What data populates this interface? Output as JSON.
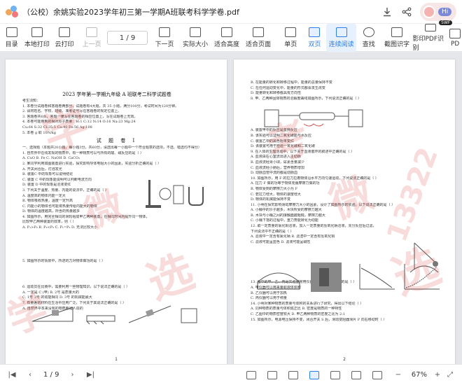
{
  "app": {
    "title": "（公校）余姚实验2023学年初三第一学期A班联考科学学卷.pdf",
    "avatar_label": "Hi"
  },
  "toolbar": {
    "items": [
      {
        "label": "目录"
      },
      {
        "label": "本地打印"
      },
      {
        "label": "云打印"
      },
      {
        "label": "上一页"
      },
      {
        "label": "下一页"
      },
      {
        "label": "实际大小"
      },
      {
        "label": "适合高度"
      },
      {
        "label": "适合页面"
      },
      {
        "label": "单页"
      },
      {
        "label": "双页"
      },
      {
        "label": "连续阅读"
      },
      {
        "label": "查找"
      },
      {
        "label": "截图识字"
      },
      {
        "label": "影印PDF识别"
      },
      {
        "label": "PD"
      }
    ],
    "page_indicator": "1 / 9",
    "badge": "SWF"
  },
  "page1": {
    "title": "2023 学年第一学期九年级 A 班联考二科学试题卷",
    "notice_head": "考生须知：",
    "notice": [
      "1. 本卷分试题卷和答题卷两部分，试题卷有4大题，共 35 小题，满分100分，考试时间为120分钟。",
      "2. 请将姓名、学校、班级、准考证号写在答题卷的规定位置上。",
      "3. 答题卷共6页，答题一律写在答题卷的相应位置上，写在试题卷上无效。",
      "4. 本卷可能用到的相对原子质量：H:1 C:12 N:14 O:16 Na:23 Mg:24",
      "   Cu:64 S:32 Cl:35.5 Ca:40 Fe:56 Ag:108",
      "5. 本卷 g 取 10N/kg"
    ],
    "section_title": "试 题 卷 Ⅰ",
    "questions": [
      "一、选择题（本题共20小题，每小题3分，共60分，请选出每一小题中一个符合题意的选项，不选、错选均不得分）",
      "1. 自然界中在线发现的物质中，有一种物质可以与所有的酸、碱反应的是（  ）",
      "  A. CuO   B. Fe   C. NaOH   D. CaCO₃",
      "2. 某同学利用如图装置进行实验，探究影响导体电阻大小的因素，实验分析正确的是（  ）",
      "  A. 开关闭合后，灯泡发光",
      "  B. 装置C 中的现象可以说明结论",
      "  C. 装置 C 中的现象能说明可以判断电流方向",
      "  D. 装置 D 中的现象是溶液变红",
      "3. 下列关于温度、热量、内能的说法中，正确的是（  ）",
      "  A. 温度高的物体内能一定大",
      "  B. 物体吸收热量，温度一定升高",
      "  C. 内能小的物体也可能将热量传给内能大的物体",
      "  D. 物体的温度越高，所含的热量越多",
      "4. 如图所示，用完全相同的滑轮组成甲乙两种装置，在相同时间内提升同一物体，",
      "  比较甲乙两种装置的效率，则（  ）",
      "  A. P₁>P₂   B. P₁<P₂   C. P₁=P₂   D. 无法比较大小",
      "5. 如图所示的情景中，所述的力对物体做功的是（  ）",
      "6. 运动员在比赛中，需要利用一些物理知识，以下说法正确的是（  ）",
      "  A. 一定是 C (甲)   B. 2号 是质量大的",
      "  C. 1号 3号 的动能相同   D. 3号 的机械能最大",
      "7. 有量差的材料在生活中应用广泛，下列关于其说法正确的是（  ）",
      "  A. 自然界中本来没有的物质都是人造的"
    ],
    "page_number": "1"
  },
  "page2": {
    "lines": [
      "B. 在能量的转化和转移过程中，能量的总量保持不变",
      "C. 在任何运动变化中，能量的形式都会发生改变",
      "D. 能量转化和转移都具有方向性",
      "8. 甲、乙两种固体物质的溶解度曲线如图所示，下列说法正确的是（  ）",
      "  A. 装置甲中的反应是置换反应",
      "  B. 该实验可以证明二氧化碳能与水反应",
      "  C. 装置乙中的黑色粉末变红",
      "  D. 该装置可用于检验一氧化碳和二氧化碳",
      "9. 在人体的生理活动中，以下关于血液循环的叙述中正确的是（  ）",
      "  A. 血液由右心室流出进入主动脉",
      "  B. 血液流经肾小球，尿素含量减少",
      "  C. 血液流经小肠后，营养物质增加",
      "  D. 动脉血管中流的都是动脉血",
      "10. 如图所示，用 F 的拉力拉着物体沿水平方向匀速运动，下列说法正确的是（  ）",
      "  A. 拉力 F 做的功等于物体克服摩擦力做的功",
      "  B. 物体受到的摩擦力大小为 F",
      "  C. 若拉力增大，物体的速度增大",
      "  D. 物体的机械能保持不变",
      "11. 小明在探究影响滑动摩擦力大小的因素，设计了如图所示的实验，以下说法正确的是（  ）",
      "  A. 小桶中的沙子越多，木块所受的摩擦力越大",
      "  B. 木块与小桶之间的接触面越粗糙，摩擦力越大",
      "  C. 小桶下落的过程中，重力势能转化为动能",
      "12. 取一定质量的氯化铜溶液，加入一定质量的氢氧化钠溶液，充分反应后过滤，",
      "  下列说法中不正确的是（  ）",
      "  A. 滤液中一定含有氯化钠     B. 滤渣中一定含有氢氧化铜",
      "  C. 滤液可能呈蓝色           D. 滤液可能呈碱性",
      "13. 图中的甲、乙、丙是实验室常用仪器，下列说法不正确的是（  ）",
      "  A. 甲仪器可以用来量取液体体积",
      "  B. 乙仪器可以用于加热",
      "  C. 丙仪器可以用于称量",
      "14. 小明对某种物质的质量与体积的关系进行了研究，得出以下结论（  ）",
      "  A. 同种物质的质量与体积成正比   B. 密度是物质的一种特性",
      "  C. 乙图中的物质密度较大         D. 甲乙两种物质的密度之比为 2:1",
      "15. 如图所示，电源电压保持不变，闭合开关 S 后，滑动变阻器滑片 P 向右移动时（  ）"
    ],
    "page_number": "2"
  },
  "statusbar": {
    "page_indicator": "1 / 9",
    "zoom": "67%"
  },
  "watermark": {
    "text_a": "学",
    "text_b": "微",
    "text_c": "选",
    "text_d": "考",
    "num": "13322"
  }
}
